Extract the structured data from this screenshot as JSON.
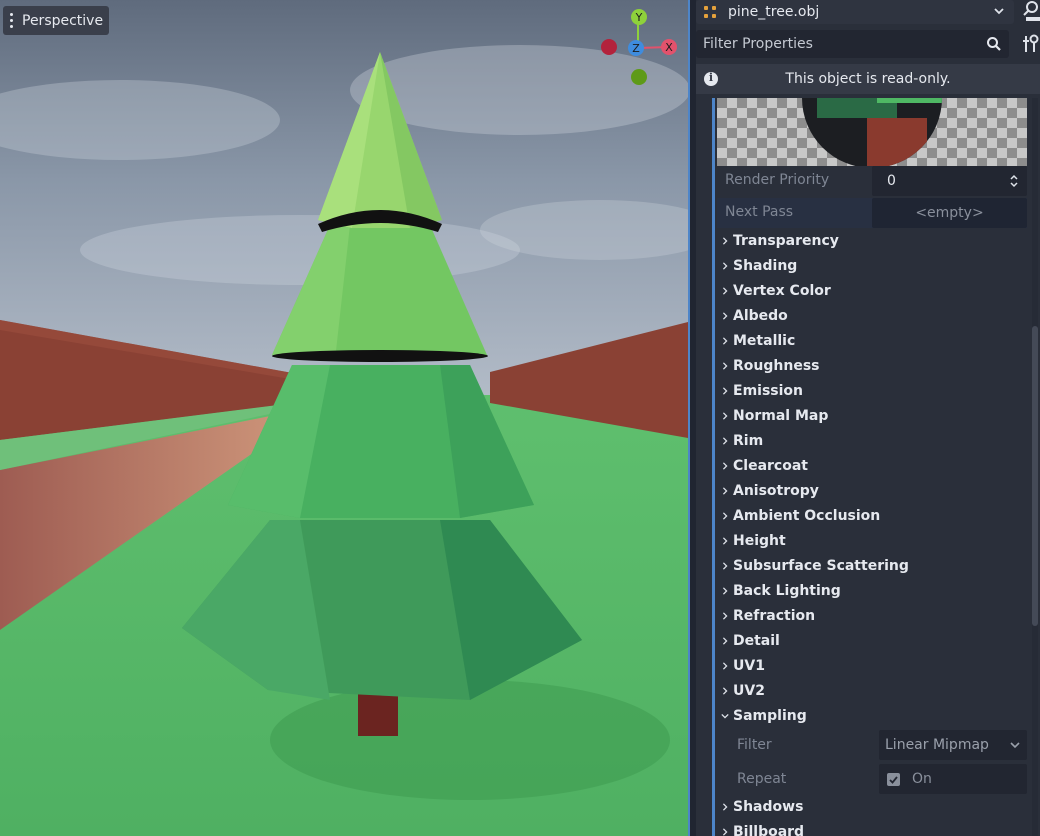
{
  "viewport": {
    "view_label": "Perspective",
    "gizmo": {
      "y": "Y",
      "z": "Z",
      "x": "X"
    }
  },
  "inspector": {
    "resource_name": "pine_tree.obj",
    "filter_placeholder": "Filter Properties",
    "readonly_message": "This object is read-only.",
    "render_priority": {
      "label": "Render Priority",
      "value": "0"
    },
    "next_pass": {
      "label": "Next Pass",
      "value": "<empty>"
    },
    "sections": [
      "Transparency",
      "Shading",
      "Vertex Color",
      "Albedo",
      "Metallic",
      "Roughness",
      "Emission",
      "Normal Map",
      "Rim",
      "Clearcoat",
      "Anisotropy",
      "Ambient Occlusion",
      "Height",
      "Subsurface Scattering",
      "Back Lighting",
      "Refraction",
      "Detail",
      "UV1",
      "UV2"
    ],
    "sampling": {
      "title": "Sampling",
      "filter": {
        "label": "Filter",
        "value": "Linear Mipmap"
      },
      "repeat": {
        "label": "Repeat",
        "value": "On",
        "checked": true
      }
    },
    "after_sections": [
      "Shadows",
      "Billboard"
    ]
  },
  "colors": {
    "accent": "#4d85c9",
    "panel": "#2a2f3a",
    "field": "#222631"
  }
}
